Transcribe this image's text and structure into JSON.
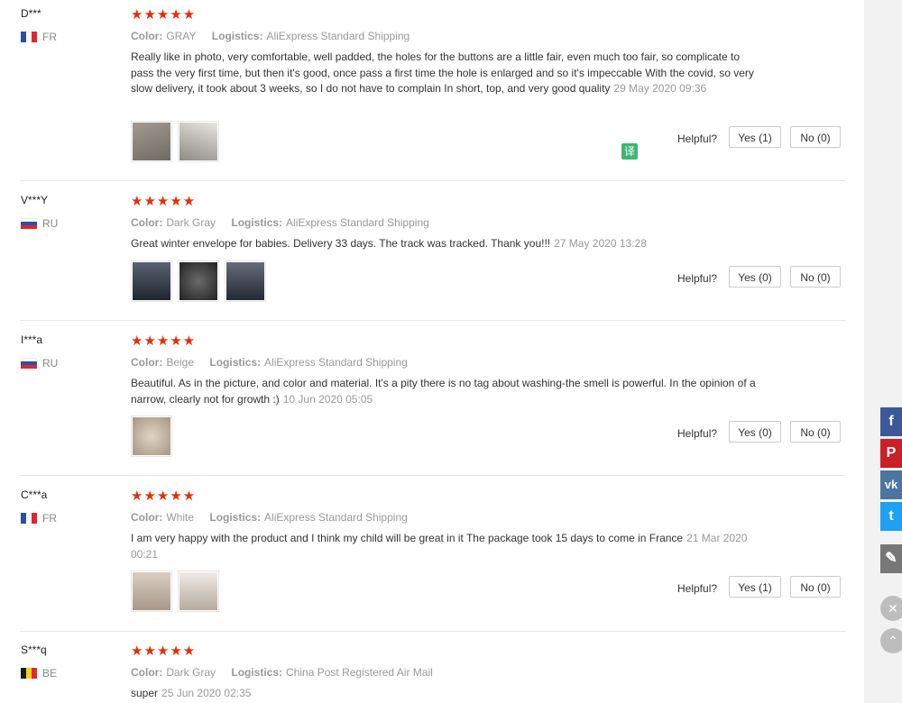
{
  "reviews": [
    {
      "user": "D***",
      "country": "FR",
      "flag": [
        "#2b4fa2",
        "#ffffff",
        "#e1262d"
      ],
      "stars": "★★★★★",
      "color_label": "Color:",
      "color_value": "GRAY",
      "logistics_label": "Logistics:",
      "logistics_value": "AliExpress Standard Shipping",
      "text": "Really like in photo, very comfortable, well padded, the holes for the buttons are a little fair, even much too fair, so complicate to pass the very first time, but then it's good, once pass a first time the hole is enlarged and so it's impeccable With the covid, so very slow delivery, it took about 3 weeks, so I do not have to complain In short, top, and very good quality",
      "date": "29 May 2020 09:36",
      "helpful_label": "Helpful?",
      "yes_label": "Yes (1)",
      "no_label": "No (0)",
      "thumbs": [
        "#8a8078",
        "#bfb8b0"
      ]
    },
    {
      "user": "V***Y",
      "country": "RU",
      "flag": [
        "#ffffff",
        "#2b4fa2",
        "#e1262d"
      ],
      "stars": "★★★★★",
      "color_label": "Color:",
      "color_value": "Dark Gray",
      "logistics_label": "Logistics:",
      "logistics_value": "AliExpress Standard Shipping",
      "text": "Great winter envelope for babies. Delivery 33 days. The track was tracked. Thank you!!!",
      "date": "27 May 2020 13:28",
      "helpful_label": "Helpful?",
      "yes_label": "Yes (0)",
      "no_label": "No (0)",
      "thumbs": [
        "#2e3540",
        "#3a3a3a",
        "#323844"
      ]
    },
    {
      "user": "I***a",
      "country": "RU",
      "flag": [
        "#ffffff",
        "#2b4fa2",
        "#e1262d"
      ],
      "stars": "★★★★★",
      "color_label": "Color:",
      "color_value": "Beige",
      "logistics_label": "Logistics:",
      "logistics_value": "AliExpress Standard Shipping",
      "text": "Beautiful. As in the picture, and color and material. It's a pity there is no tag about washing-the smell is powerful. In the opinion of a narrow, clearly not for growth :)",
      "date": "10 Jun 2020 05:05",
      "helpful_label": "Helpful?",
      "yes_label": "Yes (0)",
      "no_label": "No (0)",
      "thumbs": [
        "#c9b9a2"
      ]
    },
    {
      "user": "C***a",
      "country": "FR",
      "flag": [
        "#2b4fa2",
        "#ffffff",
        "#e1262d"
      ],
      "stars": "★★★★★",
      "color_label": "Color:",
      "color_value": "White",
      "logistics_label": "Logistics:",
      "logistics_value": "AliExpress Standard Shipping",
      "text": "I am very happy with the product and I think my child will be great in it The package took 15 days to come in France",
      "date": "21 Mar 2020 00:21",
      "helpful_label": "Helpful?",
      "yes_label": "Yes (1)",
      "no_label": "No (0)",
      "thumbs": [
        "#cdbfae",
        "#d8d2cb"
      ]
    },
    {
      "user": "S***q",
      "country": "BE",
      "flag": [
        "#1a1a1a",
        "#f7d117",
        "#e1262d"
      ],
      "stars": "★★★★★",
      "color_label": "Color:",
      "color_value": "Dark Gray",
      "logistics_label": "Logistics:",
      "logistics_value": "China Post Registered Air Mail",
      "text": "super",
      "date": "25 Jun 2020 02:35"
    }
  ],
  "translate_label": "译",
  "social": [
    {
      "name": "facebook",
      "glyph": "f",
      "color": "#3b5998"
    },
    {
      "name": "pinterest",
      "glyph": "P",
      "color": "#cb2027"
    },
    {
      "name": "vk",
      "glyph": "vk",
      "color": "#4c75a3"
    },
    {
      "name": "twitter",
      "glyph": "t",
      "color": "#1da1f2"
    },
    {
      "name": "edit",
      "glyph": "✎",
      "color": "#777777"
    }
  ],
  "close_glyph": "✕",
  "top_glyph": "⌃"
}
